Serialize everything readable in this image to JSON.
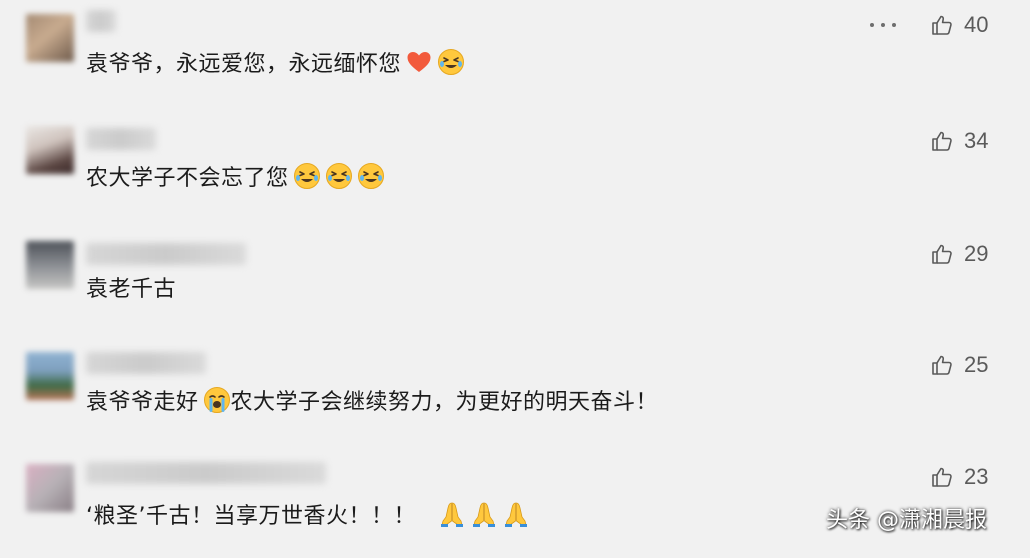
{
  "comments": [
    {
      "text": "袁爷爷，永远爱您，永远缅怀您",
      "emojis": [
        "heart",
        "crying-laughing"
      ],
      "likes": "40",
      "has_more_menu": true
    },
    {
      "text": "农大学子不会忘了您",
      "emojis": [
        "crying-laughing",
        "crying-laughing",
        "crying-laughing"
      ],
      "likes": "34"
    },
    {
      "text": "袁老千古",
      "emojis": [],
      "likes": "29"
    },
    {
      "text_before": "袁爷爷走好",
      "text_after": "农大学子会继续努力，为更好的明天奋斗！",
      "emojis": [
        "loudly-crying"
      ],
      "likes": "25"
    },
    {
      "text": "‘粮圣’千古！当享万世香火！！！",
      "emojis": [
        "folded-hands",
        "folded-hands",
        "folded-hands"
      ],
      "likes": "23"
    }
  ],
  "watermark": "头条 @潇湘晨报",
  "colors": {
    "background": "#f1f1f1",
    "text": "#1b1b1b",
    "like": "#5a5a5a",
    "emoji_yellow": "#ffc83d",
    "heart": "#f25a3c"
  }
}
